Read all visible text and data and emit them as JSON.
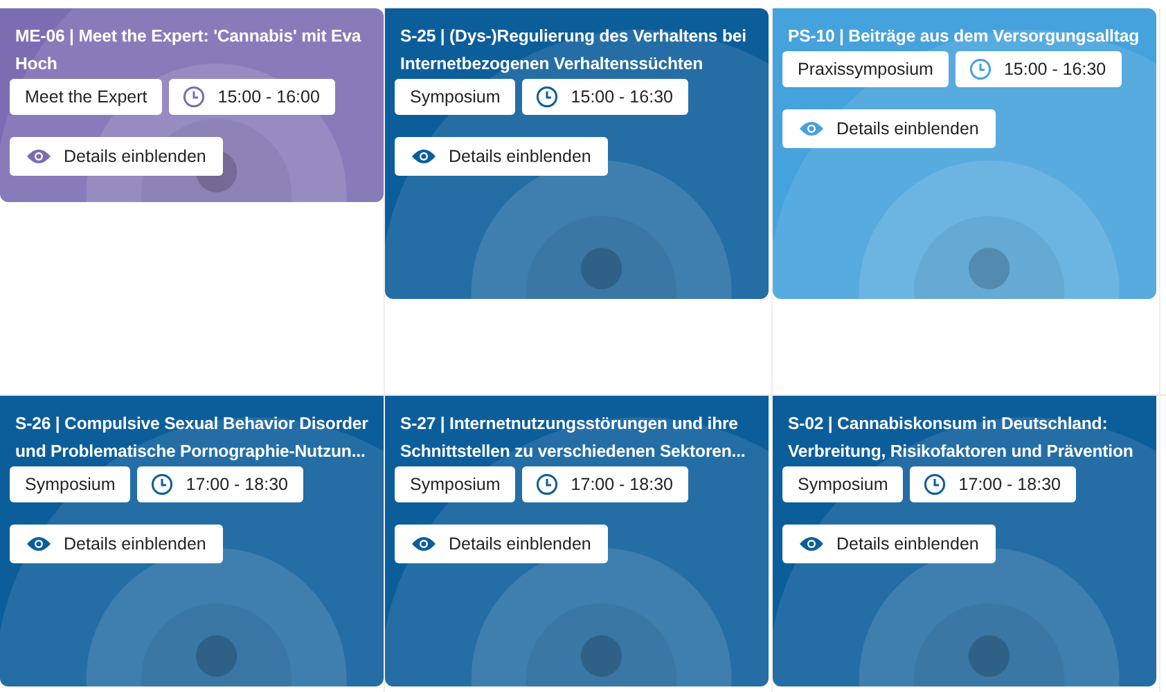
{
  "rows": [
    {
      "sessions": [
        {
          "title": "**ME-06** | Meet the Expert: 'Cannabis' mit Eva Hoch",
          "type": "Meet the Expert",
          "time": "15:00 - 16:00",
          "button": "Details einblenden",
          "color": "#7c6db3",
          "kind": "short"
        },
        {
          "title": "**S-25** | (Dys-)Regulierung des Verhaltens bei Internetbezogenen Verhaltenssüchten",
          "type": "Symposium",
          "time": "15:00 - 16:30",
          "button": "Details einblenden",
          "color": "#0c5e9b",
          "kind": "tall"
        },
        {
          "title": "**PS-10** | Beiträge aus dem Versorgungsalltag",
          "type": "Praxissymposium",
          "time": "15:00 - 16:30",
          "button": "Details einblenden",
          "color": "#46a2dc",
          "kind": "tall"
        }
      ]
    },
    {
      "sessions": [
        {
          "title": "**S-26** | Compulsive Sexual Behavior Disorder und Problematische Pornographie-Nutzun...",
          "type": "Symposium",
          "time": "17:00 - 18:30",
          "button": "Details einblenden",
          "color": "#0c5e9b",
          "kind": "tall"
        },
        {
          "title": "**S-27** | Internetnutzungsstörungen und ihre Schnittstellen zu verschiedenen Sektoren...",
          "type": "Symposium",
          "time": "17:00 - 18:30",
          "button": "Details einblenden",
          "color": "#0c5e9b",
          "kind": "tall"
        },
        {
          "title": "**S-02** | Cannabiskonsum in Deutschland: Verbreitung, Risikofaktoren und Prävention",
          "type": "Symposium",
          "time": "17:00 - 18:30",
          "button": "Details einblenden",
          "color": "#0c5e9b",
          "kind": "tall"
        }
      ]
    }
  ]
}
